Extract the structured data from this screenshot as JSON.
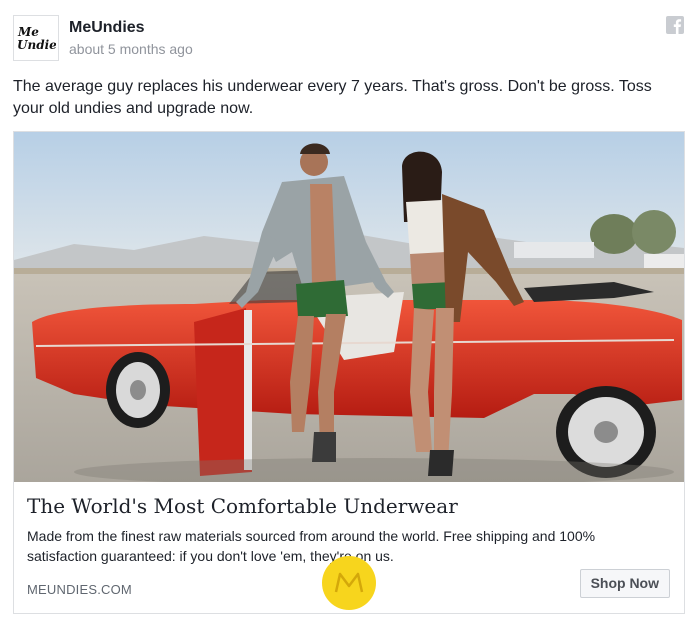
{
  "post": {
    "page_name": "MeUndies",
    "timestamp": "about 5 months ago",
    "logo_text": "MeUndies",
    "body_text": "The average guy replaces his underwear every 7 years. That's gross. Don't be gross. Toss your old undies and upgrade now."
  },
  "card": {
    "image_alt": "two models in green underwear posing beside a red vintage convertible in the desert",
    "headline": "The World's Most Comfortable Underwear",
    "description": "Made from the finest raw materials sourced from around the world. Free shipping and 100% satisfaction guaranteed: if you don't love 'em, they're on us.",
    "domain": "MEUNDIES.COM",
    "cta_label": "Shop Now"
  },
  "icons": {
    "platform": "facebook-icon",
    "watermark": "m-logo-icon"
  },
  "colors": {
    "text_primary": "#1d2129",
    "text_secondary": "#90949c",
    "car_red": "#d9291c",
    "underwear_green": "#2f6b35",
    "watermark_yellow": "#f7d51d"
  }
}
